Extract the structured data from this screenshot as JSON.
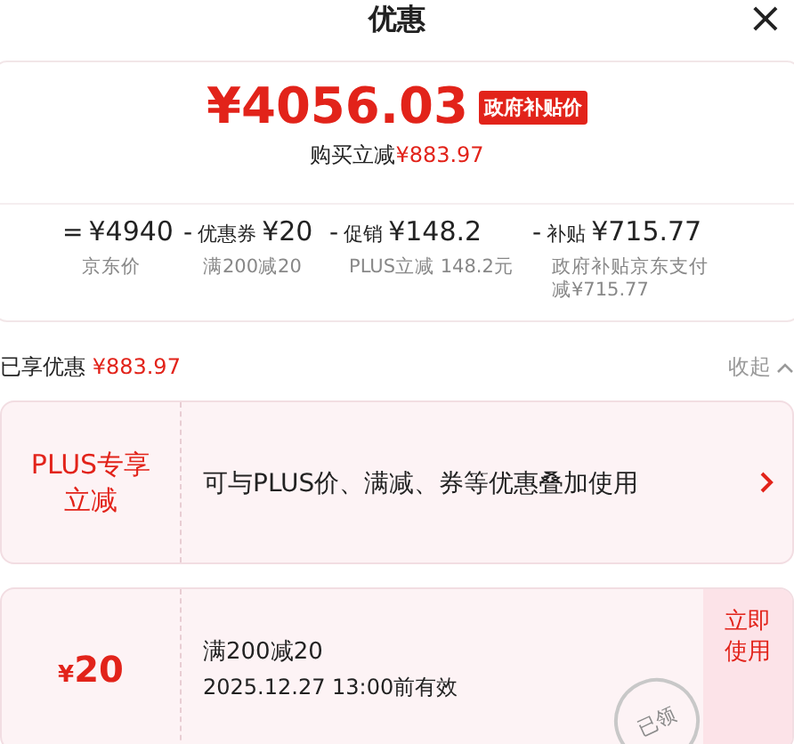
{
  "header": {
    "title": "优惠",
    "close": "×"
  },
  "summary": {
    "price": "¥4056.03",
    "badge": "政府补贴价",
    "saving_label": "购买立减",
    "saving": "¥883.97",
    "breakdown": [
      {
        "op": "=",
        "amount": "¥4940",
        "note": "京东价"
      },
      {
        "op": "-",
        "label": "优惠券",
        "amount": "¥20",
        "note": "满200减20"
      },
      {
        "op": "-",
        "label": "促销",
        "amount": "¥148.2",
        "note": "PLUS立减 148.2元"
      },
      {
        "op": "-",
        "label": "补贴",
        "amount": "¥715.77",
        "note": "政府补贴京东支付减¥715.77"
      }
    ]
  },
  "enjoyed": {
    "label": "已享优惠",
    "amount": "¥883.97",
    "toggle": "收起"
  },
  "offers": [
    {
      "kind": "promo",
      "title": "PLUS专享立减",
      "desc": "可与PLUS价、满减、券等优惠叠加使用"
    },
    {
      "kind": "coupon",
      "currency": "¥",
      "value": "20",
      "title": "满200减20",
      "validity": "2025.12.27 13:00前有效",
      "action": "立即使用",
      "stamp": "已领"
    }
  ]
}
